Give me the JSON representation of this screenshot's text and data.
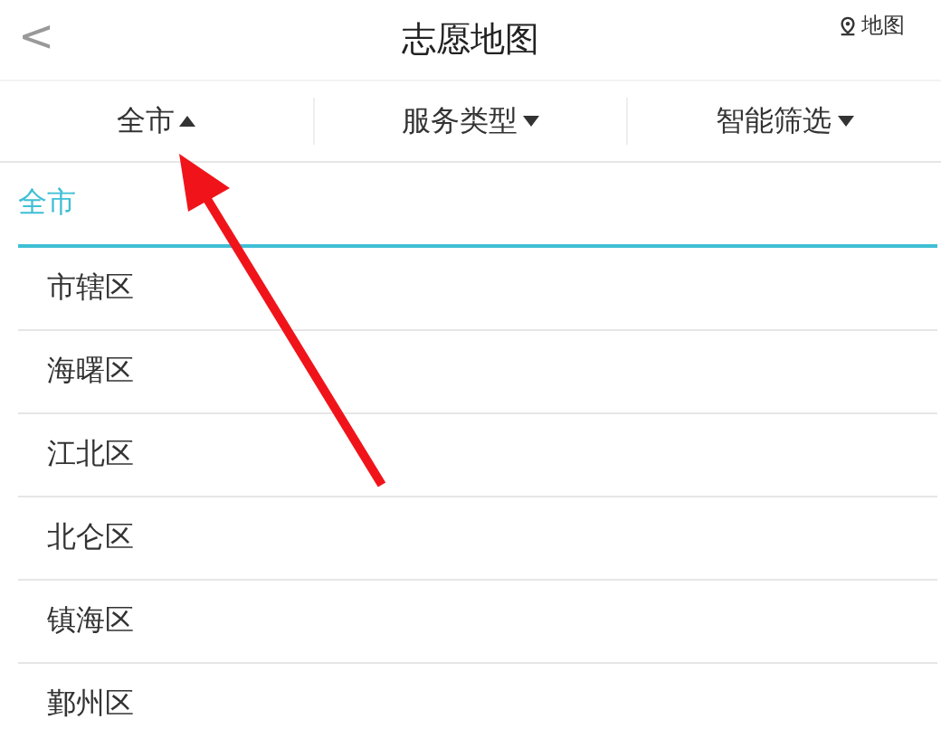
{
  "header": {
    "back": "<",
    "title": "志愿地图",
    "map_link": "地图"
  },
  "filters": [
    {
      "label": "全市",
      "expanded": true
    },
    {
      "label": "服务类型",
      "expanded": false
    },
    {
      "label": "智能筛选",
      "expanded": false
    }
  ],
  "districts": [
    {
      "label": "全市",
      "selected": true
    },
    {
      "label": "市辖区",
      "selected": false
    },
    {
      "label": "海曙区",
      "selected": false
    },
    {
      "label": "江北区",
      "selected": false
    },
    {
      "label": "北仑区",
      "selected": false
    },
    {
      "label": "镇海区",
      "selected": false
    },
    {
      "label": "鄞州区",
      "selected": false
    }
  ]
}
